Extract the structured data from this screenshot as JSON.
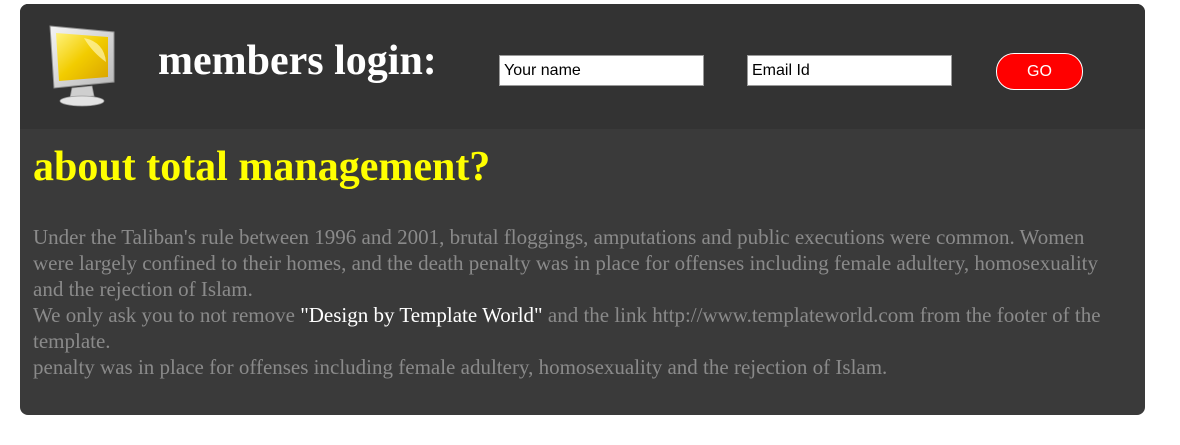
{
  "header": {
    "title": "members login:",
    "name_placeholder": "Your name",
    "email_placeholder": "Email Id",
    "go_label": "GO",
    "logo_icon": "monitor-icon"
  },
  "main": {
    "heading": "about total management?",
    "paragraph1": "Under the Taliban's rule between 1996 and 2001, brutal floggings, amputations and public executions were common. Women were largely confined to their homes, and the death penalty was in place for offenses including female adultery, homosexuality and the rejection of Islam.",
    "paragraph2_before": "We only ask you to not remove ",
    "paragraph2_highlight": "\"Design by Template World\"",
    "paragraph2_after": " and the link http://www.templateworld.com from the footer of the template.",
    "paragraph3": "penalty was in place for offenses including female adultery, homosexuality and the rejection of Islam."
  },
  "colors": {
    "panel_bg": "#3a3a3a",
    "header_bg": "#333333",
    "heading": "#ffff00",
    "body_text": "#8a8a8a",
    "button": "#ff0000"
  }
}
